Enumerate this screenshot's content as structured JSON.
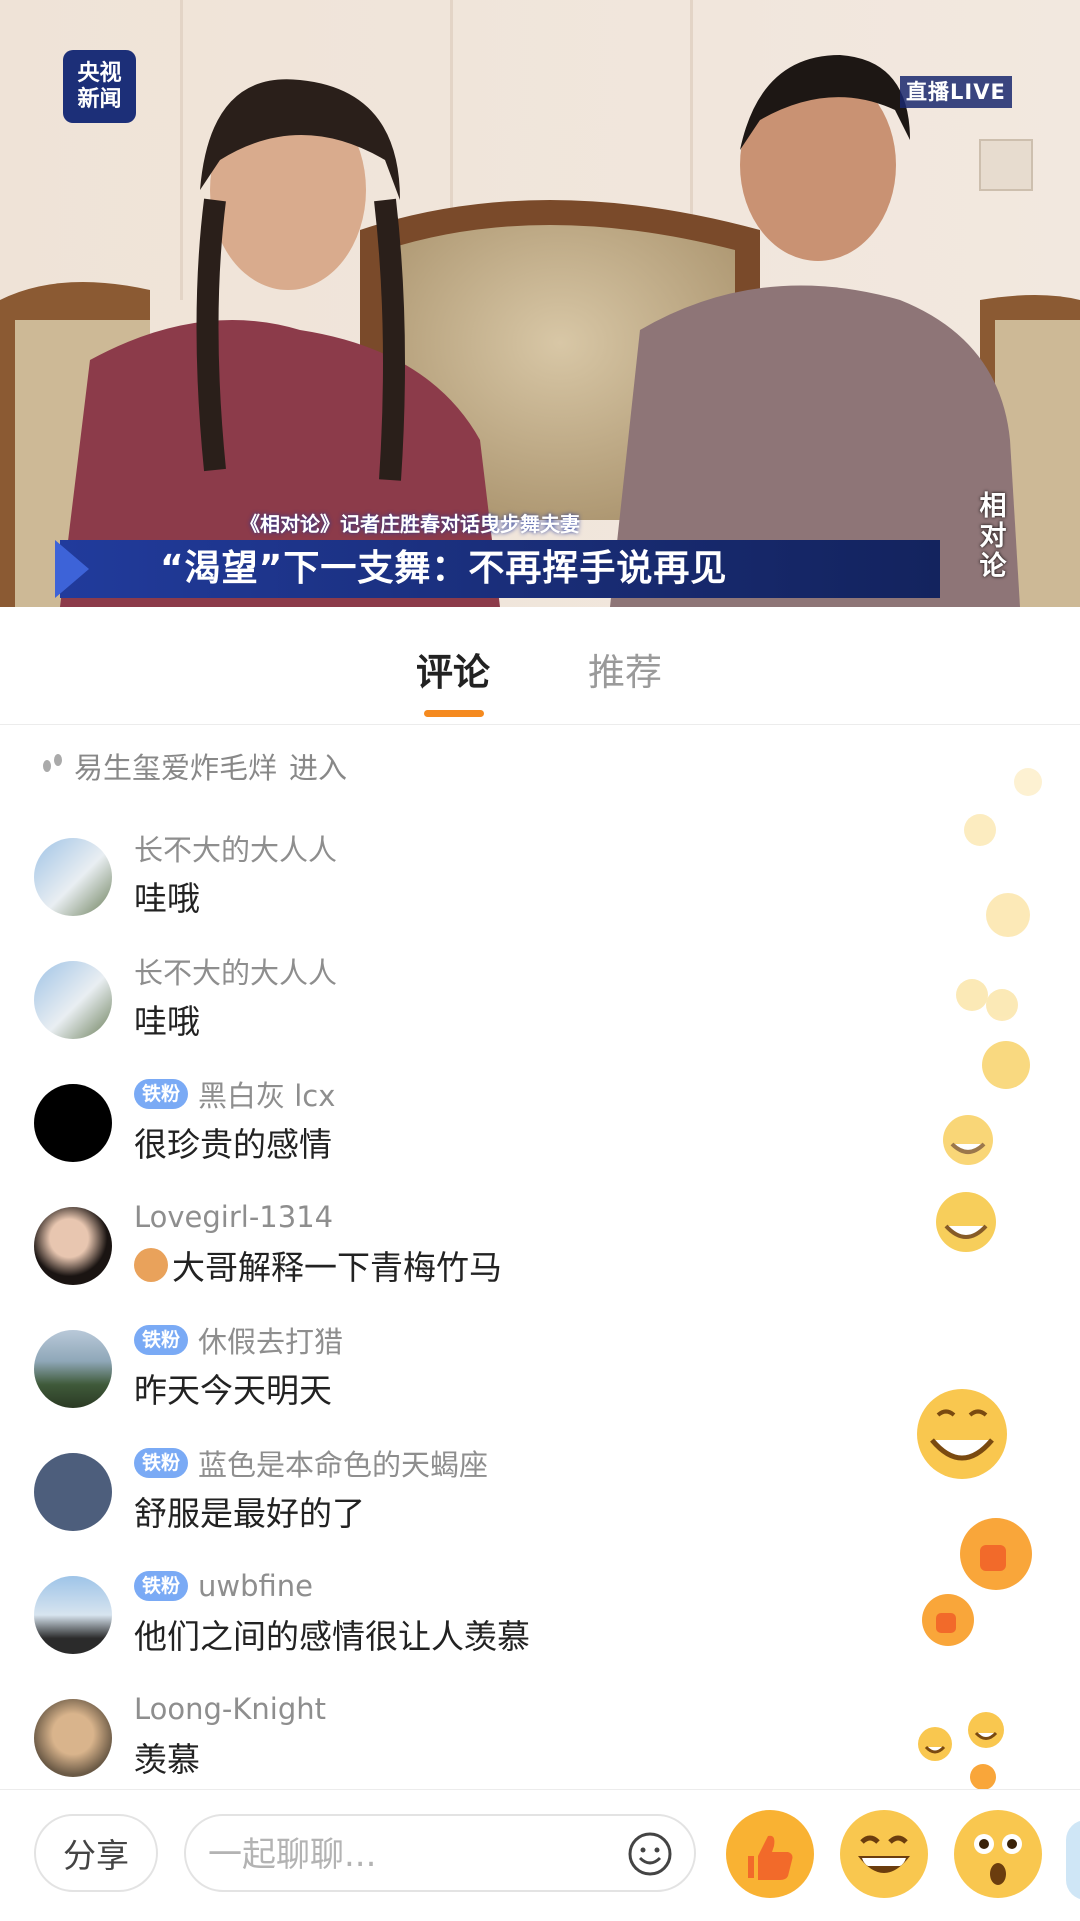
{
  "video": {
    "logo_line1": "央视",
    "logo_line2": "新闻",
    "live_label": "直播LIVE",
    "subtitle_small": "《相对论》记者庄胜春对话曳步舞夫妻",
    "headline": "“渴望”下一支舞：不再挥手说再见",
    "program_mark": [
      "相",
      "对",
      "论"
    ]
  },
  "tabs": [
    {
      "label": "评论",
      "active": true
    },
    {
      "label": "推荐",
      "active": false
    }
  ],
  "enter_notice": {
    "user": "易生玺爱炸毛烊",
    "action": "进入"
  },
  "badge_label": "铁粉",
  "comments": [
    {
      "user": "长不大的大人人",
      "text": "哇哦",
      "badge": false
    },
    {
      "user": "长不大的大人人",
      "text": "哇哦",
      "badge": false
    },
    {
      "user": "黑白灰 lcx",
      "text": "很珍贵的感情",
      "badge": true
    },
    {
      "user": "Lovegirl-1314",
      "text": "大哥解释一下青梅竹马",
      "badge": false,
      "emoji": "cat-emoji"
    },
    {
      "user": "休假去打猎",
      "text": "昨天今天明天",
      "badge": true
    },
    {
      "user": "蓝色是本命色的天蝎座",
      "text": "舒服是最好的了",
      "badge": true
    },
    {
      "user": "uwbfine",
      "text": "他们之间的感情很让人羡慕",
      "badge": true
    },
    {
      "user": "Loong-Knight",
      "text": "羡慕",
      "badge": false
    }
  ],
  "bottom": {
    "share_label": "分享",
    "chat_placeholder": "一起聊聊...",
    "reactions": [
      "thumbs-up-icon",
      "grin-icon",
      "surprised-icon"
    ]
  },
  "colors": {
    "accent": "#f58a1f",
    "badge": "#7aaaf5",
    "banner": "#1b2f80"
  }
}
